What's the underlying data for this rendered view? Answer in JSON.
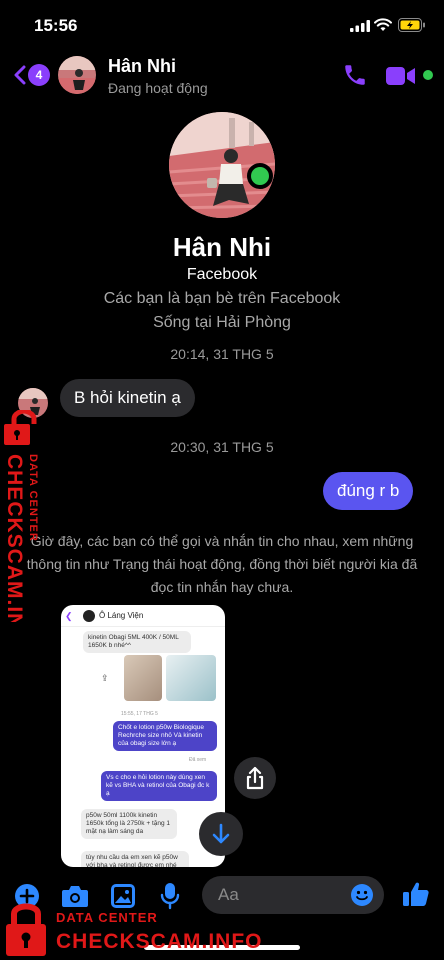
{
  "status_bar": {
    "time": "15:56"
  },
  "header": {
    "back_badge": "4",
    "name": "Hân Nhi",
    "status": "Đang hoạt động"
  },
  "profile": {
    "name": "Hân Nhi",
    "platform": "Facebook",
    "friends_text": "Các bạn là bạn bè trên Facebook",
    "location_text": "Sống tại Hải Phòng"
  },
  "conversation": {
    "timestamp_1": "20:14, 31 THG 5",
    "incoming_message": "B hỏi kinetin ạ",
    "timestamp_2": "20:30, 31 THG 5",
    "outgoing_message": "đúng r b",
    "info_text": "Giờ đây, các bạn có thể gọi và nhắn tin cho nhau, xem những thông tin như Trạng thái hoạt động, đồng thời biết người kia đã đọc tin nhắn hay chưa."
  },
  "shared_image": {
    "title": "Ô Láng Viện",
    "msg_1": "kinetin Obagi 5ML 400K / 50ML 1650K b nhé^^",
    "time": "15:55, 17 THG 5",
    "msg_2": "Chốt e lotion p50w Biologique Rechrche size nhỏ Và kinetin của obagi size lớn ạ",
    "seen": "Đã xem",
    "msg_3": "Vs c cho e hỏi lotion này dùng xen kẽ vs BHA và retinol của Obagi đc k ạ",
    "msg_4": "p50w 50ml 1100k kinetin 1650k tổng là 2750k + tặng 1 mặt nạ làm sáng da",
    "msg_5": "tùy nhu cầu da em xen kẽ p50w với bha và retinol được em nhé"
  },
  "composer": {
    "placeholder": "Aa"
  },
  "watermark": {
    "datacenter": "DATA CENTER",
    "site": "CHECKSCAM.INFO"
  },
  "colors": {
    "accent": "#8a3ffc",
    "outgoing_bubble": "#5a55f0",
    "incoming_bubble": "#2b2b2e",
    "online": "#31c950",
    "icon_blue": "#2d88ff",
    "watermark_red": "#e01818"
  },
  "icons": [
    "signal-icon",
    "wifi-icon",
    "battery-icon",
    "back-chevron-icon",
    "phone-icon",
    "video-camera-icon",
    "share-icon",
    "arrow-down-icon",
    "plus-icon",
    "camera-icon",
    "image-icon",
    "microphone-icon",
    "emoji-icon",
    "thumbs-up-icon",
    "lock-icon"
  ]
}
